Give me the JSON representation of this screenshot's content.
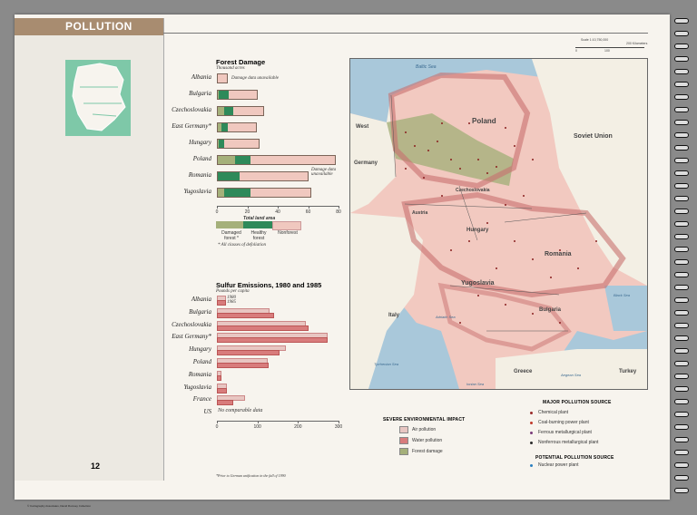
{
  "page": {
    "section_title": "POLLUTION",
    "page_number": "12",
    "copyright": "© Cartography Associates, David Rumsey Collection"
  },
  "forest_chart": {
    "title": "Forest Damage",
    "subtitle": "Thousand acres",
    "albania_note": "Damage data unavailable",
    "romania_note": "Damage data unavailable",
    "ticks": [
      "0",
      "20",
      "40",
      "60",
      "80"
    ],
    "legend": {
      "title": "Total land area",
      "damaged": "Damaged forest *",
      "healthy": "Healthy forest",
      "nonforest": "Nonforest",
      "footnote": "* All classes of defoliation"
    }
  },
  "sulfur_chart": {
    "title": "Sulfur Emissions, 1980 and 1985",
    "subtitle": "Pounds per capita",
    "legend_1980": "1980",
    "legend_1985": "1985",
    "us_note": "No comparable data",
    "ticks": [
      "0",
      "100",
      "200",
      "300"
    ],
    "footnote": "*Prior to German unification in the fall of 1990"
  },
  "chart_data": [
    {
      "type": "bar",
      "title": "Forest Damage",
      "ylabel": "Thousand acres",
      "categories": [
        "Albania",
        "Bulgaria",
        "Czechoslovakia",
        "East Germany*",
        "Hungary",
        "Poland",
        "Romania",
        "Yugoslavia"
      ],
      "series": [
        {
          "name": "Damaged forest *",
          "values": [
            null,
            1,
            5,
            3,
            1,
            12,
            null,
            5
          ]
        },
        {
          "name": "Healthy forest",
          "values": [
            null,
            7,
            6,
            4,
            4,
            10,
            15,
            17
          ]
        },
        {
          "name": "Nonforest",
          "values": [
            7,
            19,
            20,
            19,
            23,
            56,
            45,
            40
          ]
        }
      ],
      "stacked": true,
      "xlim": [
        0,
        80
      ]
    },
    {
      "type": "bar",
      "title": "Sulfur Emissions, 1980 and 1985",
      "ylabel": "Pounds per capita",
      "categories": [
        "Albania",
        "Bulgaria",
        "Czechoslovakia",
        "East Germany*",
        "Hungary",
        "Poland",
        "Romania",
        "Yugoslavia",
        "France",
        "US"
      ],
      "series": [
        {
          "name": "1980",
          "values": [
            17,
            126,
            215,
            268,
            166,
            121,
            7,
            21,
            66,
            null
          ]
        },
        {
          "name": "1985",
          "values": [
            17,
            137,
            221,
            268,
            149,
            123,
            7,
            21,
            36,
            null
          ]
        }
      ],
      "xlim": [
        0,
        300
      ]
    }
  ],
  "map": {
    "labels": {
      "baltic": "Baltic Sea",
      "west": "West",
      "germany": "Germany",
      "poland": "Poland",
      "soviet": "Soviet Union",
      "czech": "Czechoslovakia",
      "austria": "Austria",
      "hungary": "Hungary",
      "romania": "Romania",
      "yugoslavia": "Yugoslavia",
      "italy": "Italy",
      "bulgaria": "Bulgaria",
      "black_sea": "Black Sea",
      "adriatic": "Adriatic Sea",
      "tyrrhenian": "Tyrrhenian Sea",
      "greece": "Greece",
      "turkey": "Turkey",
      "aegean": "Aegean Sea",
      "ionian": "Ionian Sea"
    },
    "scale_text": "Scale 1:10,750,000",
    "scale_km": "200 Kilometers",
    "scale_vals": [
      "0",
      "100"
    ]
  },
  "impact_legend": {
    "title": "SEVERE ENVIRONMENTAL IMPACT",
    "items": [
      "Air pollution",
      "Water pollution",
      "Forest damage"
    ],
    "colors": [
      "#e8c6c2",
      "#d87c7c",
      "#a5b07a"
    ]
  },
  "source_legend": {
    "title": "MAJOR POLLUTION SOURCE",
    "items": [
      "Chemical plant",
      "Coal-burning power plant",
      "Ferrous metallurgical plant",
      "Nonferrous metallurgical plant"
    ],
    "potential_title": "POTENTIAL POLLUTION SOURCE",
    "potential_items": [
      "Nuclear power plant"
    ]
  }
}
